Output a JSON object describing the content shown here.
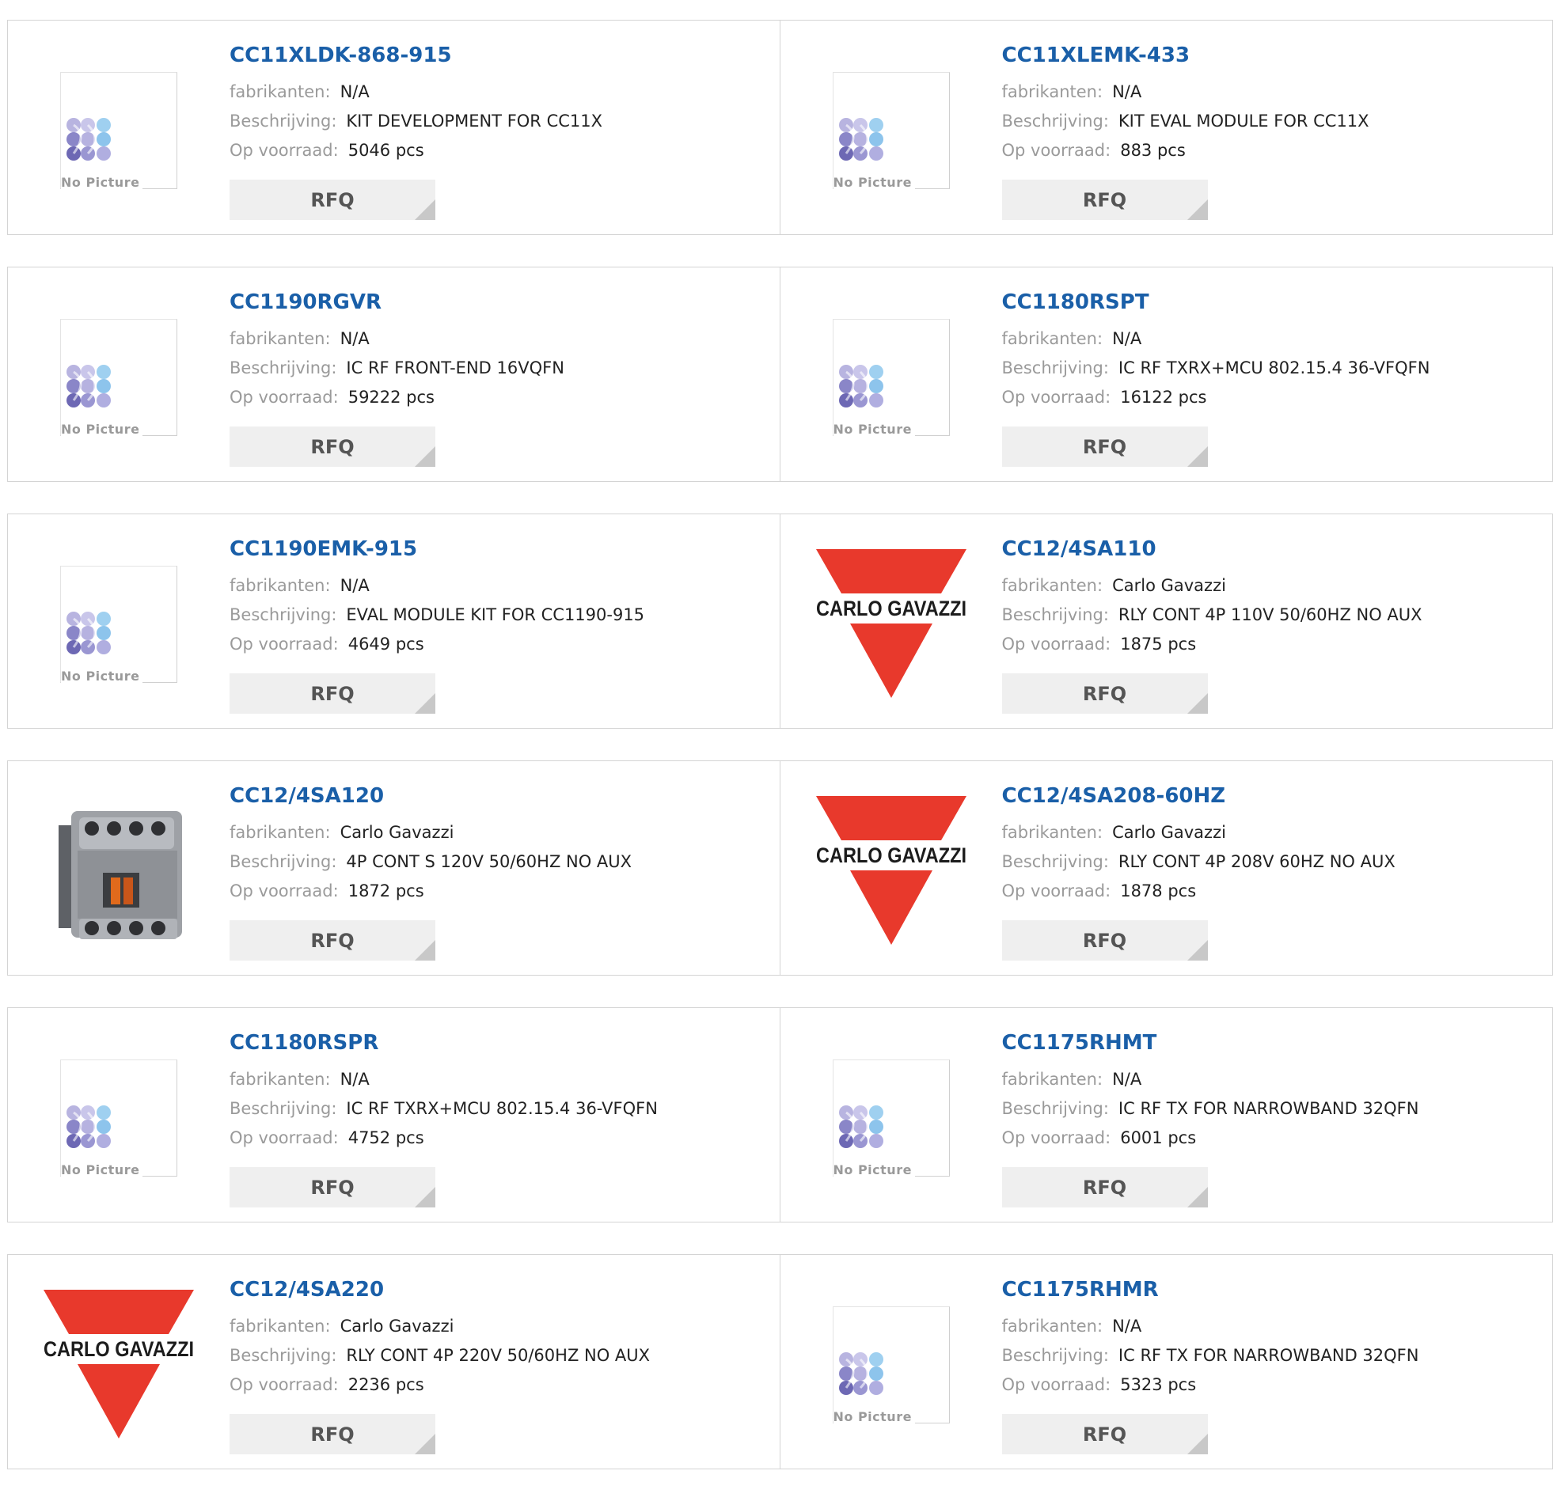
{
  "labels": {
    "manufacturer": "fabrikanten:",
    "description": "Beschrijving:",
    "stock": "Op voorraad:",
    "rfq": "RFQ",
    "no_picture": "No Picture",
    "brand_text": "CARLO GAVAZZI"
  },
  "colors": {
    "part_link": "#1a5fa8",
    "brand_red": "#e8392c"
  },
  "products": [
    {
      "part": "CC11XLDK-868-915",
      "manufacturer": "N/A",
      "description": "KIT DEVELOPMENT FOR CC11X",
      "stock": "5046 pcs",
      "image": "no-picture"
    },
    {
      "part": "CC11XLEMK-433",
      "manufacturer": "N/A",
      "description": "KIT EVAL MODULE FOR CC11X",
      "stock": "883 pcs",
      "image": "no-picture"
    },
    {
      "part": "CC1190RGVR",
      "manufacturer": "N/A",
      "description": "IC RF FRONT-END 16VQFN",
      "stock": "59222 pcs",
      "image": "no-picture"
    },
    {
      "part": "CC1180RSPT",
      "manufacturer": "N/A",
      "description": "IC RF TXRX+MCU 802.15.4 36-VFQFN",
      "stock": "16122 pcs",
      "image": "no-picture"
    },
    {
      "part": "CC1190EMK-915",
      "manufacturer": "N/A",
      "description": "EVAL MODULE KIT FOR CC1190-915",
      "stock": "4649 pcs",
      "image": "no-picture"
    },
    {
      "part": "CC12/4SA110",
      "manufacturer": "Carlo Gavazzi",
      "description": "RLY CONT 4P 110V 50/60HZ NO AUX",
      "stock": "1875 pcs",
      "image": "carlo-gavazzi-logo"
    },
    {
      "part": "CC12/4SA120",
      "manufacturer": "Carlo Gavazzi",
      "description": "4P CONT S 120V 50/60HZ NO AUX",
      "stock": "1872 pcs",
      "image": "contactor-photo"
    },
    {
      "part": "CC12/4SA208-60HZ",
      "manufacturer": "Carlo Gavazzi",
      "description": "RLY CONT 4P 208V 60HZ NO AUX",
      "stock": "1878 pcs",
      "image": "carlo-gavazzi-logo"
    },
    {
      "part": "CC1180RSPR",
      "manufacturer": "N/A",
      "description": "IC RF TXRX+MCU 802.15.4 36-VFQFN",
      "stock": "4752 pcs",
      "image": "no-picture"
    },
    {
      "part": "CC1175RHMT",
      "manufacturer": "N/A",
      "description": "IC RF TX FOR NARROWBAND 32QFN",
      "stock": "6001 pcs",
      "image": "no-picture"
    },
    {
      "part": "CC12/4SA220",
      "manufacturer": "Carlo Gavazzi",
      "description": "RLY CONT 4P 220V 50/60HZ NO AUX",
      "stock": "2236 pcs",
      "image": "carlo-gavazzi-logo"
    },
    {
      "part": "CC1175RHMR",
      "manufacturer": "N/A",
      "description": "IC RF TX FOR NARROWBAND 32QFN",
      "stock": "5323 pcs",
      "image": "no-picture"
    }
  ]
}
